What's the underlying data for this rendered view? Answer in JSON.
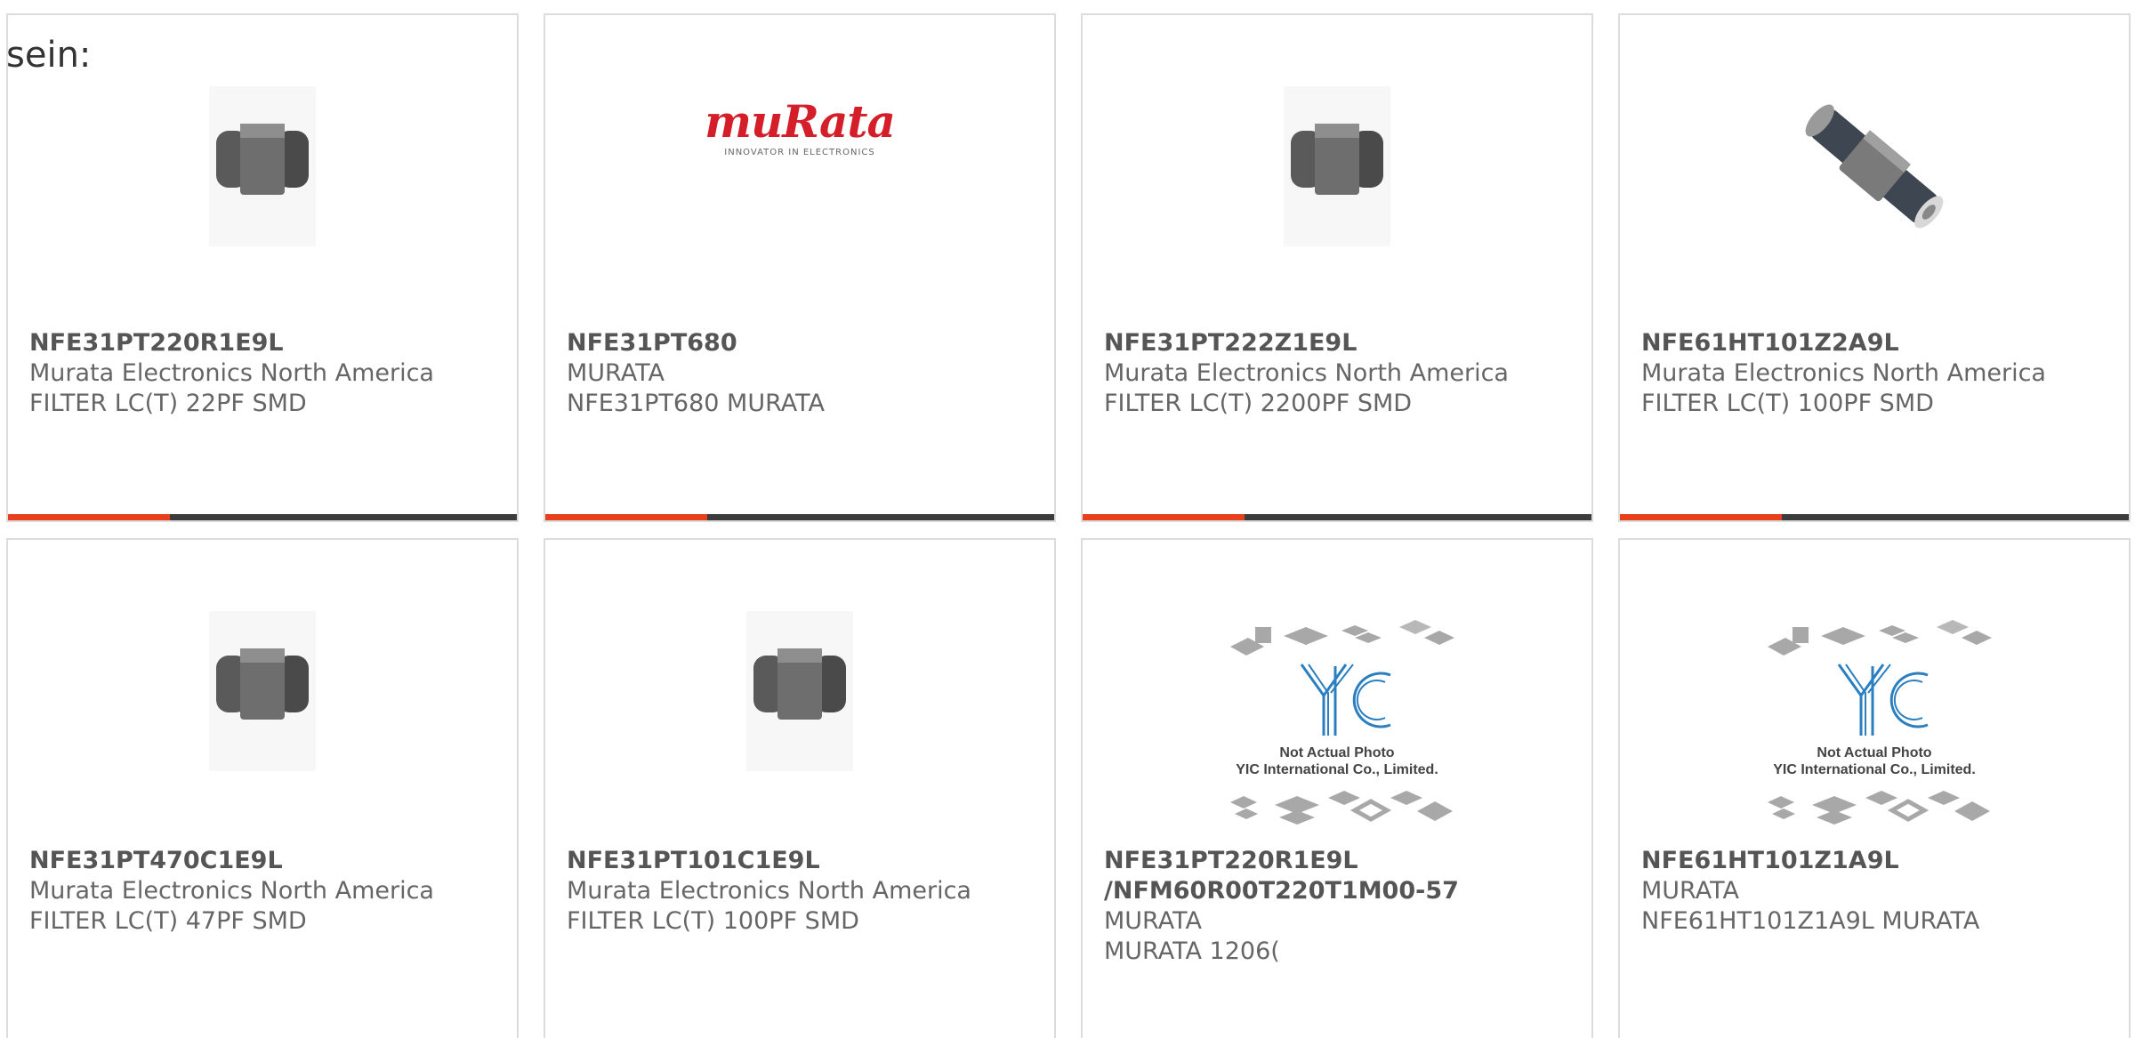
{
  "intro_text": "sein:",
  "colors": {
    "accent": "#e8401c",
    "bar": "#3c3c3c",
    "border": "#dcdcdc",
    "text": "#666666",
    "murata_red": "#d41e29",
    "yic_blue": "#2b7fc0"
  },
  "products": [
    {
      "part_number": "NFE31PT220R1E9L",
      "manufacturer": "Murata Electronics North America",
      "description": "FILTER LC(T) 22PF SMD",
      "image": "component-image"
    },
    {
      "part_number": "NFE31PT680",
      "manufacturer": "MURATA",
      "description": "NFE31PT680 MURATA",
      "image": "murata-logo",
      "logo_word": "muRata",
      "logo_tagline": "INNOVATOR IN ELECTRONICS"
    },
    {
      "part_number": "NFE31PT222Z1E9L",
      "manufacturer": "Murata Electronics North America",
      "description": "FILTER LC(T) 2200PF SMD",
      "image": "component-image"
    },
    {
      "part_number": "NFE61HT101Z2A9L",
      "manufacturer": "Murata Electronics North America",
      "description": "FILTER LC(T) 100PF SMD",
      "image": "component-image"
    },
    {
      "part_number": "NFE31PT470C1E9L",
      "manufacturer": "Murata Electronics North America",
      "description": "FILTER LC(T) 47PF SMD",
      "image": "component-image"
    },
    {
      "part_number": "NFE31PT101C1E9L",
      "manufacturer": "Murata Electronics North America",
      "description": "FILTER LC(T) 100PF SMD",
      "image": "component-image"
    },
    {
      "part_number": "NFE31PT220R1E9L",
      "part_number_line2": "/NFM60R00T220T1M00-57",
      "manufacturer": "MURATA",
      "description": "MURATA 1206(",
      "image": "yic-placeholder",
      "placeholder_line1": "Not Actual Photo",
      "placeholder_line2": "YIC International Co., Limited."
    },
    {
      "part_number": "NFE61HT101Z1A9L",
      "manufacturer": "MURATA",
      "description": "NFE61HT101Z1A9L MURATA",
      "image": "yic-placeholder",
      "placeholder_line1": "Not Actual Photo",
      "placeholder_line2": "YIC International Co., Limited."
    }
  ]
}
